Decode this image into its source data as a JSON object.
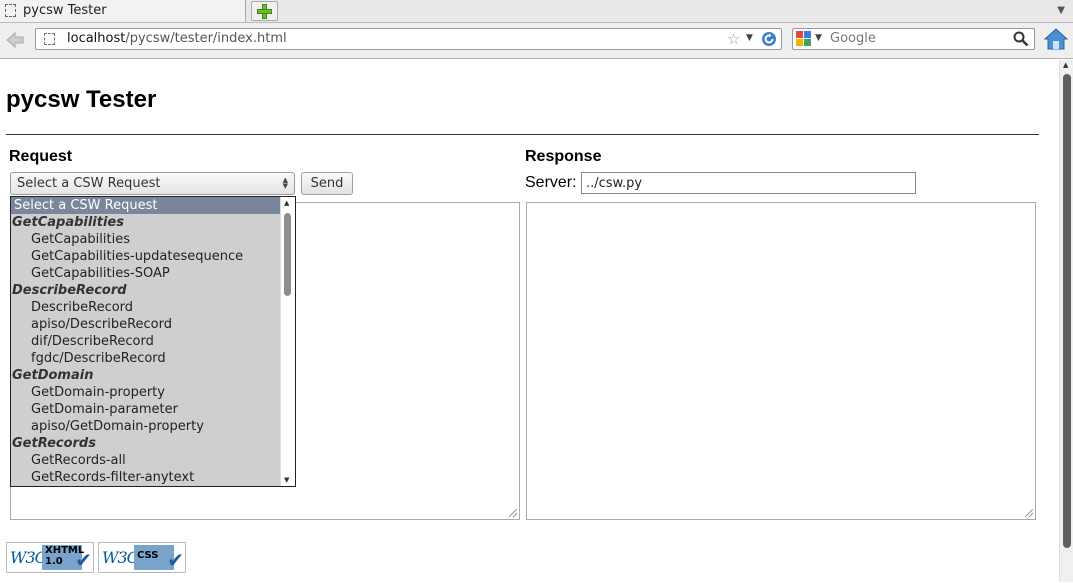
{
  "browser": {
    "tab_title": "pycsw Tester",
    "url_host": "localhost",
    "url_path": "/pycsw/tester/index.html",
    "search_placeholder": "Google"
  },
  "page": {
    "title": "pycsw Tester",
    "request_heading": "Request",
    "response_heading": "Response",
    "select_value": "Select a CSW Request",
    "send_label": "Send",
    "server_label": "Server:",
    "server_value": "../csw.py"
  },
  "dropdown": {
    "selected": "Select a CSW Request",
    "rows": [
      {
        "type": "selected",
        "label": "Select a CSW Request"
      },
      {
        "type": "group",
        "label": "GetCapabilities"
      },
      {
        "type": "opt",
        "label": "GetCapabilities"
      },
      {
        "type": "opt",
        "label": "GetCapabilities-updatesequence"
      },
      {
        "type": "opt",
        "label": "GetCapabilities-SOAP"
      },
      {
        "type": "group",
        "label": "DescribeRecord"
      },
      {
        "type": "opt",
        "label": "DescribeRecord"
      },
      {
        "type": "opt",
        "label": "apiso/DescribeRecord"
      },
      {
        "type": "opt",
        "label": "dif/DescribeRecord"
      },
      {
        "type": "opt",
        "label": "fgdc/DescribeRecord"
      },
      {
        "type": "group",
        "label": "GetDomain"
      },
      {
        "type": "opt",
        "label": "GetDomain-property"
      },
      {
        "type": "opt",
        "label": "GetDomain-parameter"
      },
      {
        "type": "opt",
        "label": "apiso/GetDomain-property"
      },
      {
        "type": "group",
        "label": "GetRecords"
      },
      {
        "type": "opt",
        "label": "GetRecords-all"
      },
      {
        "type": "opt",
        "label": "GetRecords-filter-anytext"
      }
    ]
  },
  "badges": [
    {
      "logo": "W3C",
      "line1": "XHTML",
      "line2": "1.0"
    },
    {
      "logo": "W3C",
      "line1": "CSS",
      "line2": ""
    }
  ],
  "icons": {
    "tab": "page-icon",
    "new_tab": "plus-icon",
    "back": "back-arrow-icon",
    "bookmark": "star-icon",
    "reload": "reload-icon",
    "search_engine": "google-icon",
    "search": "magnifier-icon",
    "home": "home-icon"
  },
  "colors": {
    "dropdown_bg": "#cfcfcf",
    "selected_row": "#7a869a",
    "new_tab_plus": "#6cbf2a"
  }
}
